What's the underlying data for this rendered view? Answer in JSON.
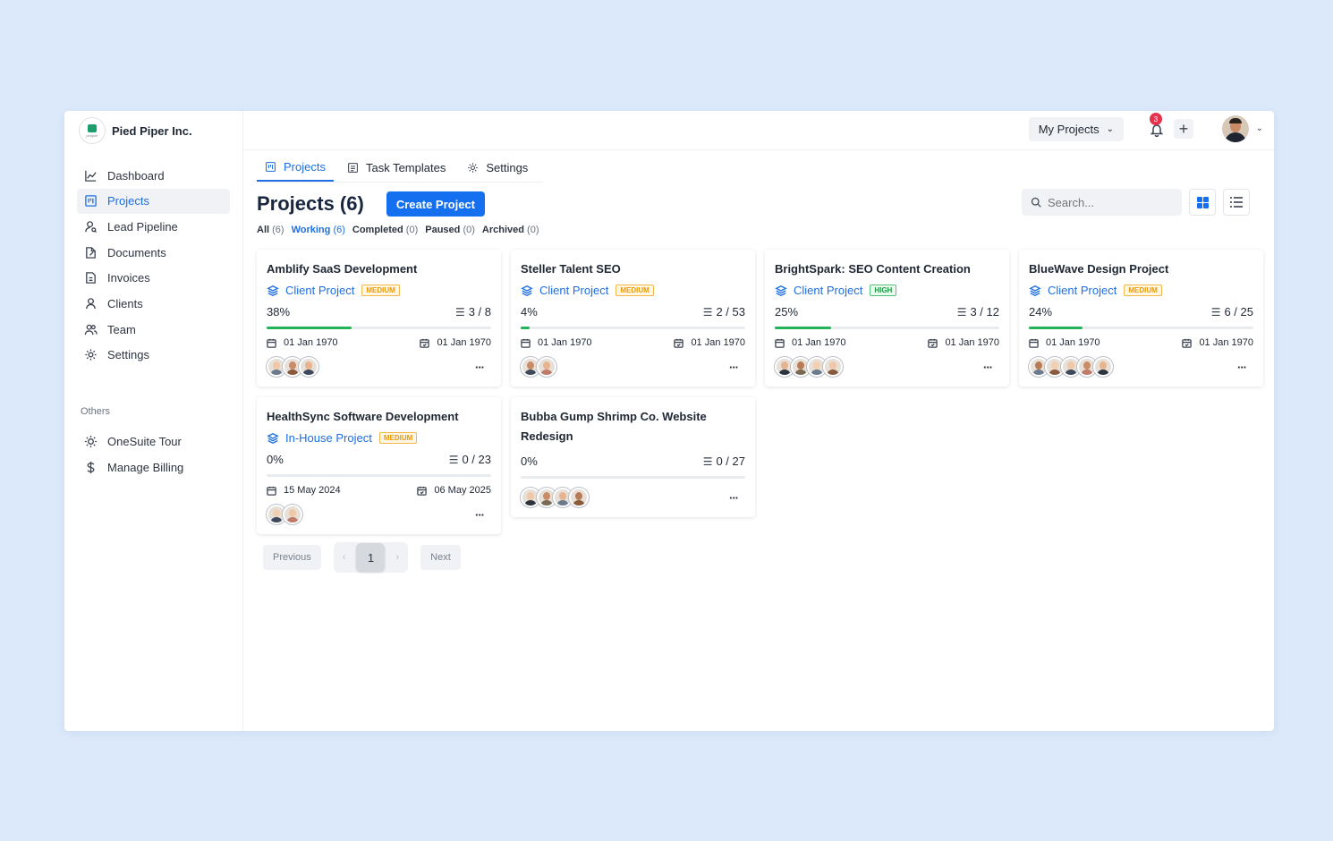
{
  "org": {
    "name": "Pied Piper Inc.",
    "logo_text": "pedpier"
  },
  "sidebar": {
    "items": [
      {
        "label": "Dashboard",
        "icon": "chart-icon"
      },
      {
        "label": "Projects",
        "icon": "projects-icon",
        "active": true
      },
      {
        "label": "Lead Pipeline",
        "icon": "person-search-icon"
      },
      {
        "label": "Documents",
        "icon": "document-icon"
      },
      {
        "label": "Invoices",
        "icon": "invoice-icon"
      },
      {
        "label": "Clients",
        "icon": "person-icon"
      },
      {
        "label": "Team",
        "icon": "team-icon"
      },
      {
        "label": "Settings",
        "icon": "gear-icon"
      }
    ],
    "others_label": "Others",
    "others": [
      {
        "label": "OneSuite Tour",
        "icon": "sun-icon"
      },
      {
        "label": "Manage Billing",
        "icon": "dollar-icon"
      }
    ]
  },
  "topbar": {
    "my_projects": "My Projects",
    "notifications": "3"
  },
  "tabs": [
    {
      "label": "Projects",
      "icon": "projects-icon",
      "active": true
    },
    {
      "label": "Task Templates",
      "icon": "list-icon"
    },
    {
      "label": "Settings",
      "icon": "gear-icon"
    }
  ],
  "header": {
    "title": "Projects (6)",
    "create": "Create Project",
    "search_placeholder": "Search..."
  },
  "filters": [
    {
      "label": "All",
      "count": "(6)"
    },
    {
      "label": "Working",
      "count": "(6)",
      "active": true
    },
    {
      "label": "Completed",
      "count": "(0)"
    },
    {
      "label": "Paused",
      "count": "(0)"
    },
    {
      "label": "Archived",
      "count": "(0)"
    }
  ],
  "projects": [
    {
      "title": "Amblify SaaS Development",
      "type": "Client Project",
      "priority": "MEDIUM",
      "progress": 38,
      "progress_text": "38%",
      "tasks": "3 / 8",
      "start": "01 Jan 1970",
      "end": "01 Jan 1970",
      "members": 3
    },
    {
      "title": "Steller Talent SEO",
      "type": "Client Project",
      "priority": "MEDIUM",
      "progress": 4,
      "progress_text": "4%",
      "tasks": "2 / 53",
      "start": "01 Jan 1970",
      "end": "01 Jan 1970",
      "members": 2
    },
    {
      "title": "BrightSpark: SEO Content Creation",
      "type": "Client Project",
      "priority": "HIGH",
      "progress": 25,
      "progress_text": "25%",
      "tasks": "3 / 12",
      "start": "01 Jan 1970",
      "end": "01 Jan 1970",
      "members": 4
    },
    {
      "title": "BlueWave Design Project",
      "type": "Client Project",
      "priority": "MEDIUM",
      "progress": 24,
      "progress_text": "24%",
      "tasks": "6 / 25",
      "start": "01 Jan 1970",
      "end": "01 Jan 1970",
      "members": 5
    },
    {
      "title": "HealthSync Software Development",
      "type": "In-House Project",
      "priority": "MEDIUM",
      "progress": 0,
      "progress_text": "0%",
      "tasks": "0 / 23",
      "start": "15 May 2024",
      "end": "06 May 2025",
      "members": 2
    },
    {
      "title": "Bubba Gump Shrimp Co. Website Redesign",
      "type": "",
      "priority": "",
      "progress": 0,
      "progress_text": "0%",
      "tasks": "0 / 27",
      "start": "",
      "end": "",
      "members": 4
    }
  ],
  "pagination": {
    "previous": "Previous",
    "page": "1",
    "next": "Next"
  },
  "colors": {
    "accent": "#1570ef",
    "progress": "#21b25a",
    "medium": "#e89b0c",
    "high": "#1a9a45"
  }
}
